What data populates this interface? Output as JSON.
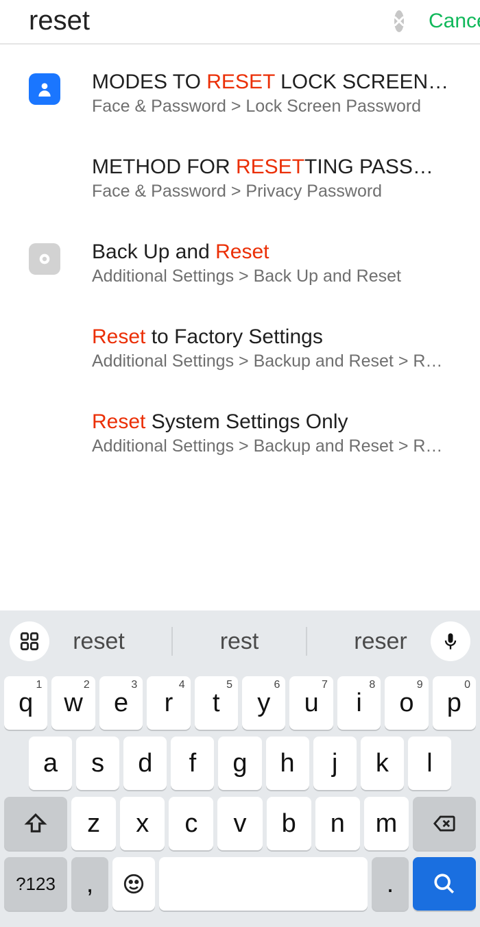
{
  "search": {
    "value": "reset",
    "cancel_label": "Cancel"
  },
  "results": [
    {
      "icon": "contact",
      "title_pre": "MODES TO ",
      "title_hl": "RESET",
      "title_post": " LOCK SCREEN P..",
      "sub": "Face & Password > Lock Screen Password"
    },
    {
      "icon": "",
      "title_pre": "METHOD FOR ",
      "title_hl": "RESET",
      "title_post": "TING PASSWO..",
      "sub": "Face & Password > Privacy Password"
    },
    {
      "icon": "gear",
      "title_pre": "Back Up and ",
      "title_hl": "Reset",
      "title_post": "",
      "sub": "Additional Settings > Back Up and Reset"
    },
    {
      "icon": "",
      "title_pre": "",
      "title_hl": "Reset",
      "title_post": " to Factory Settings",
      "sub": "Additional Settings > Backup and Reset > Reset t.."
    },
    {
      "icon": "",
      "title_pre": "",
      "title_hl": "Reset",
      "title_post": " System Settings Only",
      "sub": "Additional Settings > Backup and Reset > Reset t.."
    }
  ],
  "keyboard": {
    "suggestions": [
      "reset",
      "rest",
      "reser"
    ],
    "row1": [
      {
        "k": "q",
        "s": "1"
      },
      {
        "k": "w",
        "s": "2"
      },
      {
        "k": "e",
        "s": "3"
      },
      {
        "k": "r",
        "s": "4"
      },
      {
        "k": "t",
        "s": "5"
      },
      {
        "k": "y",
        "s": "6"
      },
      {
        "k": "u",
        "s": "7"
      },
      {
        "k": "i",
        "s": "8"
      },
      {
        "k": "o",
        "s": "9"
      },
      {
        "k": "p",
        "s": "0"
      }
    ],
    "row2": [
      "a",
      "s",
      "d",
      "f",
      "g",
      "h",
      "j",
      "k",
      "l"
    ],
    "row3": [
      "z",
      "x",
      "c",
      "v",
      "b",
      "n",
      "m"
    ],
    "symbols_label": "?123",
    "comma": ",",
    "dot": "."
  }
}
